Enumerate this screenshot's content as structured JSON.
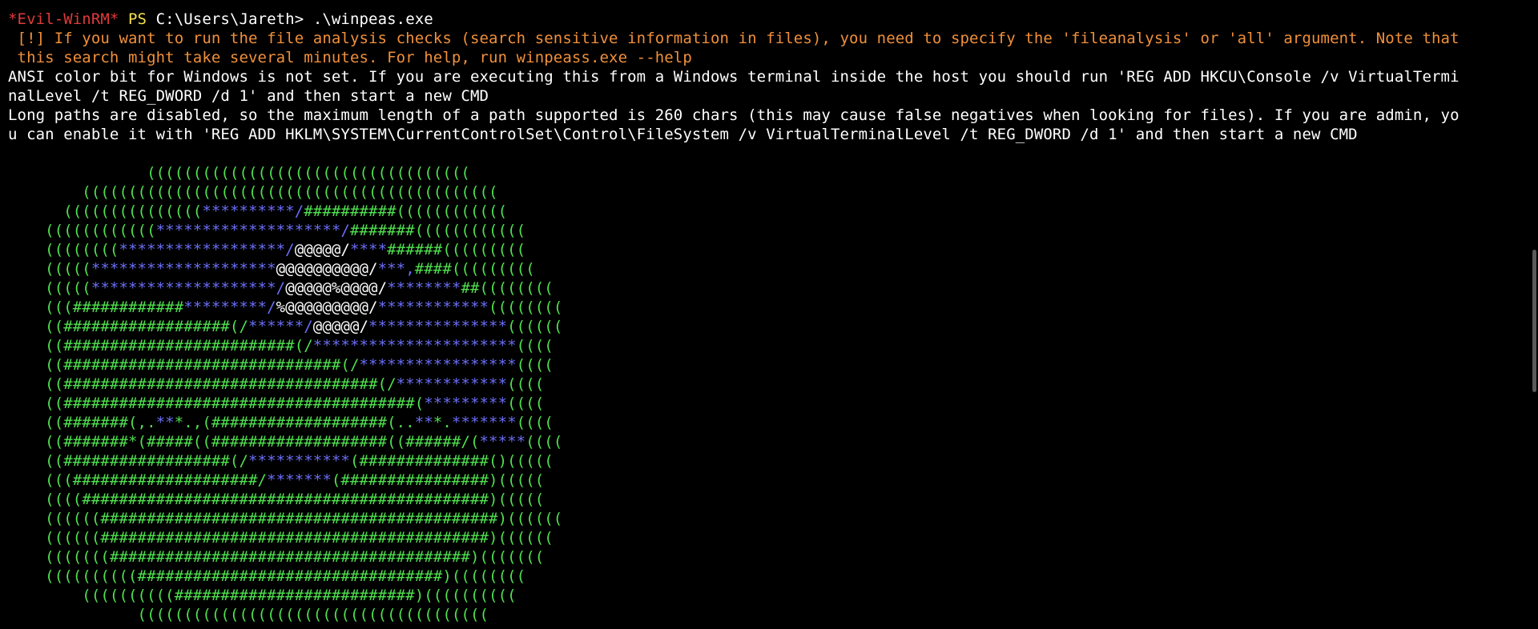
{
  "terminal": {
    "prompt": {
      "session": "*Evil-WinRM*",
      "shell": "PS",
      "path": "C:\\Users\\Jareth>",
      "command": ".\\winpeas.exe"
    },
    "messages": {
      "warning_1": " [!] If you want to run the file analysis checks (search sensitive information in files), you need to specify the 'fileanalysis' or 'all' argument. Note that",
      "warning_2": " this search might take several minutes. For help, run winpeass.exe --help",
      "ansi_1": "ANSI color bit for Windows is not set. If you are executing this from a Windows terminal inside the host you should run 'REG ADD HKCU\\Console /v VirtualTermi",
      "ansi_2": "nalLevel /t REG_DWORD /d 1' and then start a new CMD",
      "longpath_1": "Long paths are disabled, so the maximum length of a path supported is 260 chars (this may cause false negatives when looking for files). If you are admin, yo",
      "longpath_2": "u can enable it with 'REG ADD HKLM\\SYSTEM\\CurrentControlSet\\Control\\FileSystem /v VirtualTerminalLevel /t REG_DWORD /d 1' and then start a new CMD"
    },
    "colors": {
      "background": "#000000",
      "evil_winrm": "#e03a3a",
      "ps": "#f4e04d",
      "warning": "#f0903a",
      "art_green": "#4fe04f",
      "art_blue": "#6a6ef5",
      "text": "#ffffff"
    },
    "ascii_art": [
      [
        [
          "g",
          "               ((((((((((((((((((((((((((((((((((("
        ]
      ],
      [
        [
          "g",
          "        ((((((((((((((((((((((((((((((((((((((((((((("
        ]
      ],
      [
        [
          "g",
          "      ((((((((((((((("
        ],
        [
          "b",
          "**********/"
        ],
        [
          "g",
          "##########(((((((((((("
        ]
      ],
      [
        [
          "g",
          "    (((((((((((("
        ],
        [
          "b",
          "********************/"
        ],
        [
          "g",
          "#######(((((((((((("
        ]
      ],
      [
        [
          "g",
          "    (((((((("
        ],
        [
          "b",
          "******************/"
        ],
        [
          "w",
          "@@@@@/"
        ],
        [
          "b",
          "****"
        ],
        [
          "g",
          "######((((((((("
        ]
      ],
      [
        [
          "g",
          "    ((((("
        ],
        [
          "b",
          "********************"
        ],
        [
          "w",
          "@@@@@@@@@@/"
        ],
        [
          "b",
          "***,"
        ],
        [
          "g",
          "####((((((((("
        ]
      ],
      [
        [
          "g",
          "    ((((("
        ],
        [
          "b",
          "********************/"
        ],
        [
          "w",
          "@@@@@%@@@@/"
        ],
        [
          "b",
          "********"
        ],
        [
          "g",
          "##(((((((("
        ]
      ],
      [
        [
          "g",
          "    ((("
        ],
        [
          "g",
          "############"
        ],
        [
          "b",
          "*********/"
        ],
        [
          "w",
          "%@@@@@@@@@/"
        ],
        [
          "b",
          "************"
        ],
        [
          "g",
          "(((((((("
        ]
      ],
      [
        [
          "g",
          "    (("
        ],
        [
          "g",
          "##################(/"
        ],
        [
          "b",
          "******/"
        ],
        [
          "w",
          "@@@@@/"
        ],
        [
          "b",
          "***************"
        ],
        [
          "g",
          "(((((("
        ]
      ],
      [
        [
          "g",
          "    (("
        ],
        [
          "g",
          "#########################(/"
        ],
        [
          "b",
          "**********************"
        ],
        [
          "g",
          "(((("
        ]
      ],
      [
        [
          "g",
          "    (("
        ],
        [
          "g",
          "##############################(/"
        ],
        [
          "b",
          "*****************"
        ],
        [
          "g",
          "(((("
        ]
      ],
      [
        [
          "g",
          "    (("
        ],
        [
          "g",
          "##################################(/"
        ],
        [
          "b",
          "************"
        ],
        [
          "g",
          "(((("
        ]
      ],
      [
        [
          "g",
          "    (("
        ],
        [
          "g",
          "######################################("
        ],
        [
          "b",
          "*********"
        ],
        [
          "g",
          "(((("
        ]
      ],
      [
        [
          "g",
          "    (("
        ],
        [
          "g",
          "#######(,."
        ],
        [
          "b",
          "**"
        ],
        [
          "g",
          "*.,("
        ],
        [
          "g",
          "###################(.."
        ],
        [
          "b",
          "**"
        ],
        [
          "g",
          "*."
        ],
        [
          "b",
          "*******"
        ],
        [
          "g",
          "(((("
        ]
      ],
      [
        [
          "g",
          "    (("
        ],
        [
          "g",
          "#######*(#####(("
        ],
        [
          "g",
          "###################(("
        ],
        [
          "g",
          "######/("
        ],
        [
          "b",
          "*****"
        ],
        [
          "g",
          "(((("
        ]
      ],
      [
        [
          "g",
          "    (("
        ],
        [
          "g",
          "##################(/"
        ],
        [
          "b",
          "***********"
        ],
        [
          "g",
          "(##############()((((("
        ]
      ],
      [
        [
          "g",
          "    ((("
        ],
        [
          "g",
          "####################/"
        ],
        [
          "b",
          "*******"
        ],
        [
          "g",
          "(################)((((("
        ]
      ],
      [
        [
          "g",
          "    (((("
        ],
        [
          "g",
          "############################################)((((("
        ]
      ],
      [
        [
          "g",
          "    (((((("
        ],
        [
          "g",
          "###########################################)(((((("
        ]
      ],
      [
        [
          "g",
          "    (((((("
        ],
        [
          "g",
          "##########################################)(((((("
        ]
      ],
      [
        [
          "g",
          "    ((((((("
        ],
        [
          "g",
          "#######################################)((((((("
        ]
      ],
      [
        [
          "g",
          "    (((((((((("
        ],
        [
          "g",
          "#################################)(((((((("
        ]
      ],
      [
        [
          "g",
          "        (((((((((("
        ],
        [
          "g",
          "##########################)(((((((((("
        ]
      ],
      [
        [
          "g",
          "              (((((((((((((((((((((((((((((((((((((("
        ]
      ]
    ]
  }
}
